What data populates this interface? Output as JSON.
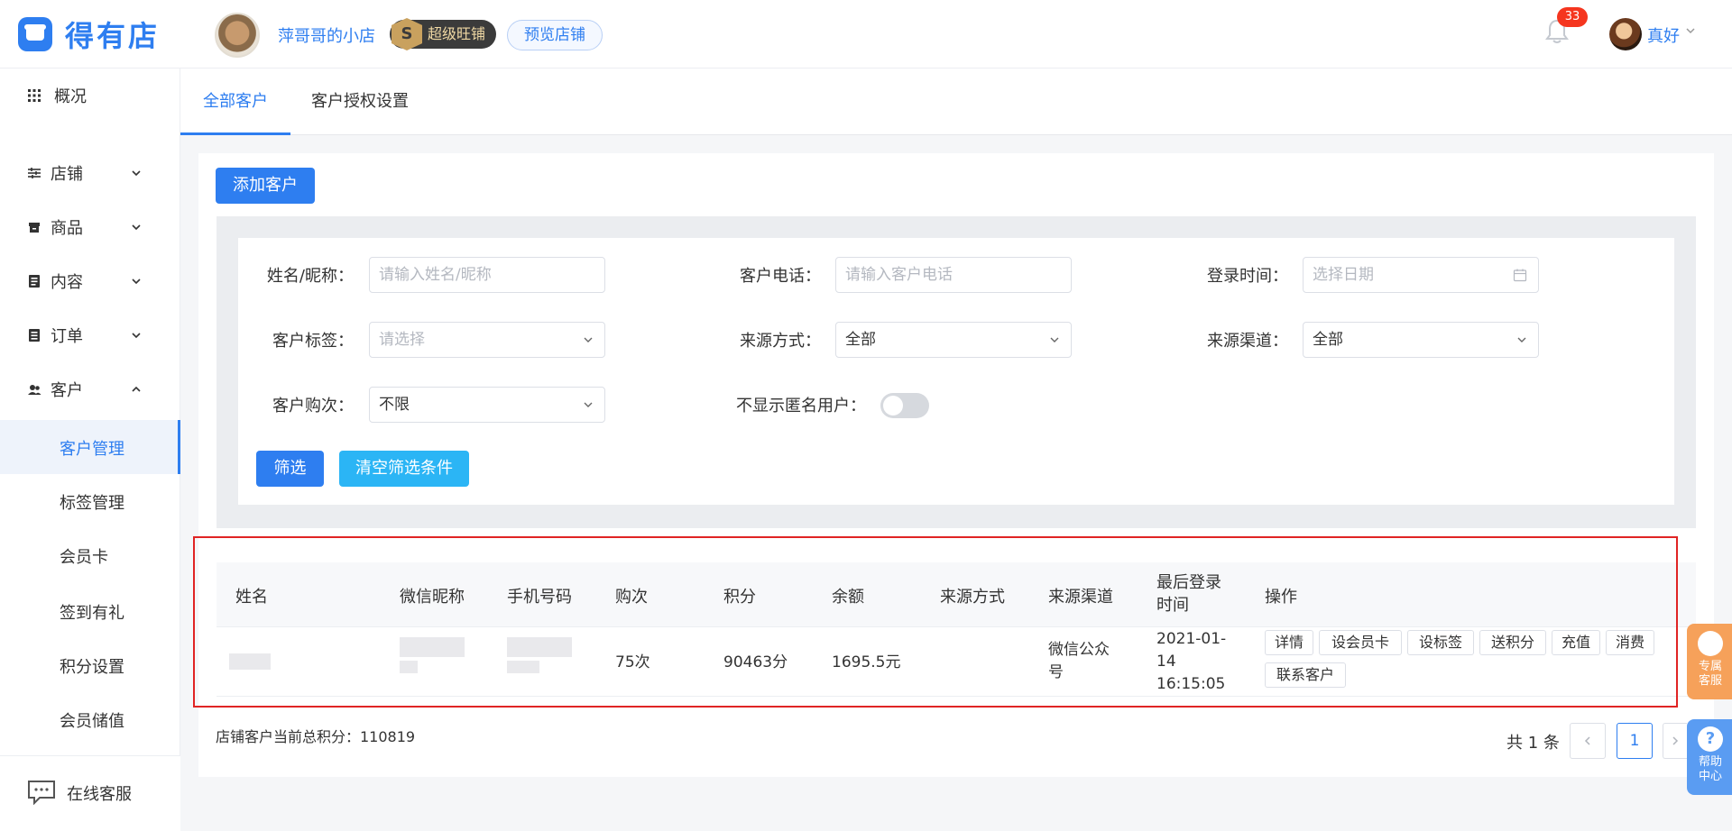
{
  "header": {
    "logo_text": "得有店",
    "shop_name": "萍哥哥的小店",
    "super_badge": "超级旺铺",
    "super_badge_icon": "S",
    "preview_button": "预览店铺",
    "notification_count": "33",
    "user_name": "真好"
  },
  "sidebar": {
    "items": [
      {
        "label": "概况",
        "icon": "grid-icon"
      },
      {
        "label": "店铺",
        "icon": "sliders-icon"
      },
      {
        "label": "商品",
        "icon": "box-icon"
      },
      {
        "label": "内容",
        "icon": "doc-icon"
      },
      {
        "label": "订单",
        "icon": "list-icon"
      },
      {
        "label": "客户",
        "icon": "users-icon"
      }
    ],
    "sub_items": [
      "客户管理",
      "标签管理",
      "会员卡",
      "签到有礼",
      "积分设置",
      "会员储值"
    ],
    "bottom_label": "在线客服"
  },
  "tabs": [
    {
      "label": "全部客户",
      "active": true
    },
    {
      "label": "客户授权设置",
      "active": false
    }
  ],
  "add_customer_button": "添加客户",
  "filters": {
    "name_label": "姓名/昵称：",
    "name_placeholder": "请输入姓名/昵称",
    "phone_label": "客户电话：",
    "phone_placeholder": "请输入客户电话",
    "login_label": "登录时间：",
    "login_placeholder": "选择日期",
    "tag_label": "客户标签：",
    "tag_placeholder": "请选择",
    "source_method_label": "来源方式：",
    "source_method_value": "全部",
    "source_channel_label": "来源渠道：",
    "source_channel_value": "全部",
    "purchase_label": "客户购次：",
    "purchase_value": "不限",
    "anonymous_label": "不显示匿名用户：",
    "filter_button": "筛选",
    "clear_button": "清空筛选条件"
  },
  "table": {
    "headers": [
      "姓名",
      "微信昵称",
      "手机号码",
      "购次",
      "积分",
      "余额",
      "来源方式",
      "来源渠道",
      "最后登录时间",
      "操作"
    ],
    "rows": [
      {
        "purchases": "75次",
        "points": "90463分",
        "balance": "1695.5元",
        "source_method": "",
        "source_channel": "微信公众号",
        "last_login": "2021-01-14 16:15:05",
        "actions": [
          "详情",
          "设会员卡",
          "设标签",
          "送积分",
          "充值",
          "消费",
          "联系客户"
        ]
      }
    ]
  },
  "footer": {
    "total_points_text": "店铺客户当前总积分：110819",
    "page_total": "共 1 条",
    "current_page": "1"
  },
  "float_widgets": {
    "service": [
      "专属",
      "客服"
    ],
    "help": [
      "帮助",
      "中心"
    ]
  },
  "colors": {
    "accent": "#2e7ef0",
    "highlight_box": "#e02424",
    "badge": "#f5361f"
  }
}
